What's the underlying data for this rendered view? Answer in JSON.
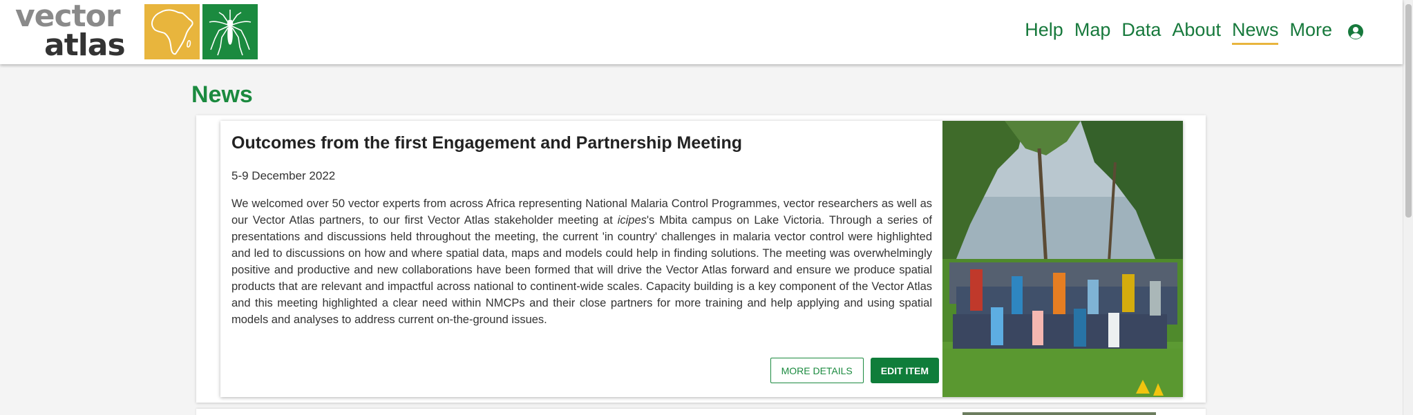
{
  "header": {
    "logo_line1": "vector",
    "logo_line2": "atlas",
    "nav": [
      {
        "label": "Help"
      },
      {
        "label": "Map"
      },
      {
        "label": "Data"
      },
      {
        "label": "About"
      },
      {
        "label": "News",
        "active": true
      },
      {
        "label": "More"
      }
    ],
    "user_icon": "account-circle-icon"
  },
  "page": {
    "title": "News"
  },
  "news_item": {
    "title": "Outcomes from the first Engagement and Partnership Meeting",
    "date": "5-9 December 2022",
    "body_before_italic": "We welcomed over 50 vector experts from across Africa  representing National Malaria Control Programmes, vector researchers as well as our Vector Atlas partners, to our first Vector Atlas stakeholder meeting at ",
    "body_italic": "icipes",
    "body_after_italic": "'s Mbita campus on Lake Victoria.  Through a series of presentations and discussions held throughout the meeting, the current 'in country' challenges in malaria vector control were highlighted and led to discussions on how and where spatial data, maps and models could help in finding solutions. The meeting was overwhelmingly positive and productive and new collaborations have been formed that will drive the Vector Atlas forward and ensure  we produce spatial products that are relevant and impactful across national to continent-wide scales. Capacity building is a key component of the Vector Atlas and this meeting highlighted a clear need within NMCPs and their close partners for more training and help applying and using spatial models and analyses to address current on-the-ground issues.",
    "more_details_label": "MORE DETAILS",
    "edit_item_label": "EDIT ITEM"
  },
  "colors": {
    "brand_green": "#1b8a3f",
    "brand_yellow": "#e8b53d",
    "nav_green": "#17793c"
  }
}
